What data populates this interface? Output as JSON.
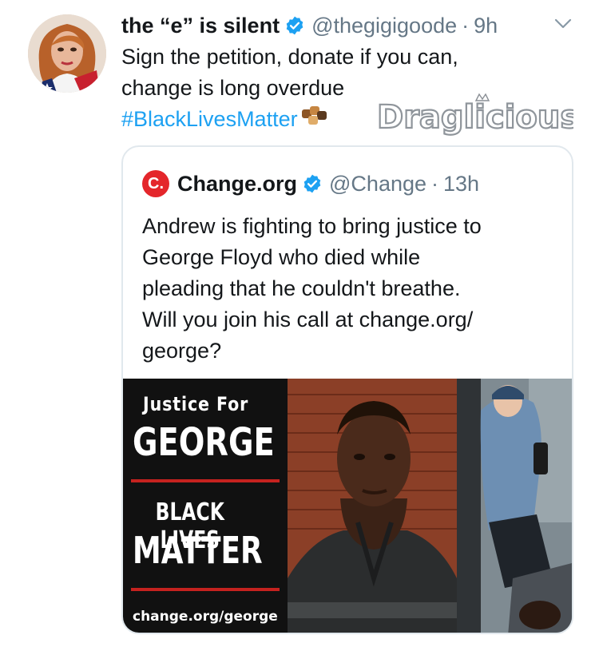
{
  "tweet": {
    "display_name": "the “e” is silent",
    "handle": "@thegigigoode",
    "separator": "·",
    "time": "9h",
    "text_lines": [
      "Sign the petition, donate if you can,",
      "change is long overdue"
    ],
    "hashtag": "#BlackLivesMatter",
    "watermark": "Draglicious"
  },
  "quote": {
    "logo_text": "C.",
    "display_name": "Change.org",
    "handle": "@Change",
    "separator": "·",
    "time": "13h",
    "text_lines": [
      "Andrew is fighting to bring justice to",
      "George Floyd who died while",
      "pleading that he couldn't breathe.",
      "Will you join his call at change.org/",
      "george?"
    ],
    "poster": {
      "line1": "Justice For",
      "line2": "GEORGE",
      "line3": "BLACK LIVES",
      "line4": "MATTER",
      "url": "change.org/george"
    }
  },
  "colors": {
    "text": "#14171a",
    "secondary": "#657786",
    "link": "#1da1f2",
    "verified": "#1da1f2",
    "change_red": "#e4262b",
    "border": "#e1e8ed",
    "poster_bg": "#111111",
    "poster_accent": "#c5221f"
  },
  "icons": {
    "verified": "verified-badge-icon",
    "caret": "chevron-down-icon",
    "fists": "raised-fist-emoji-icon"
  }
}
